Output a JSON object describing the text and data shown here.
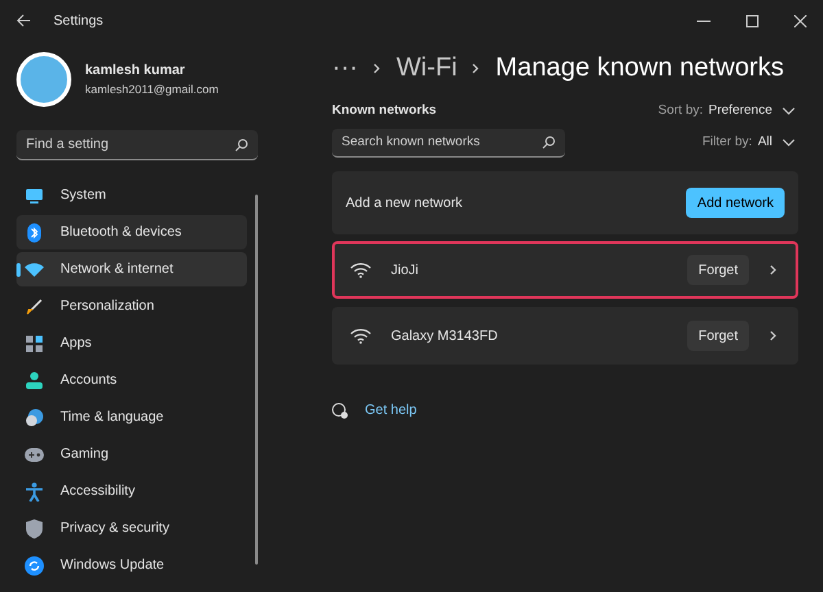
{
  "window": {
    "title": "Settings"
  },
  "profile": {
    "name": "kamlesh kumar",
    "email": "kamlesh2011@gmail.com"
  },
  "sidebar": {
    "search": {
      "placeholder": "Find a setting"
    },
    "items": [
      {
        "label": "System",
        "selected": false,
        "hovered": false
      },
      {
        "label": "Bluetooth & devices",
        "selected": false,
        "hovered": true
      },
      {
        "label": "Network & internet",
        "selected": true,
        "hovered": false
      },
      {
        "label": "Personalization",
        "selected": false,
        "hovered": false
      },
      {
        "label": "Apps",
        "selected": false,
        "hovered": false
      },
      {
        "label": "Accounts",
        "selected": false,
        "hovered": false
      },
      {
        "label": "Time & language",
        "selected": false,
        "hovered": false
      },
      {
        "label": "Gaming",
        "selected": false,
        "hovered": false
      },
      {
        "label": "Accessibility",
        "selected": false,
        "hovered": false
      },
      {
        "label": "Privacy & security",
        "selected": false,
        "hovered": false
      },
      {
        "label": "Windows Update",
        "selected": false,
        "hovered": false
      }
    ]
  },
  "breadcrumb": [
    {
      "label": "···"
    },
    {
      "label": "Wi-Fi"
    },
    {
      "label": "Manage known networks"
    }
  ],
  "known_networks": {
    "heading": "Known networks",
    "search": {
      "placeholder": "Search known networks"
    },
    "sort": {
      "label": "Sort by:",
      "value": "Preference"
    },
    "filter": {
      "label": "Filter by:",
      "value": "All"
    },
    "add": {
      "label": "Add a new network",
      "button": "Add network"
    },
    "networks": [
      {
        "name": "JioJi",
        "button": "Forget",
        "highlighted": true
      },
      {
        "name": "Galaxy M3143FD",
        "button": "Forget",
        "highlighted": false
      }
    ]
  },
  "help": {
    "label": "Get help"
  }
}
